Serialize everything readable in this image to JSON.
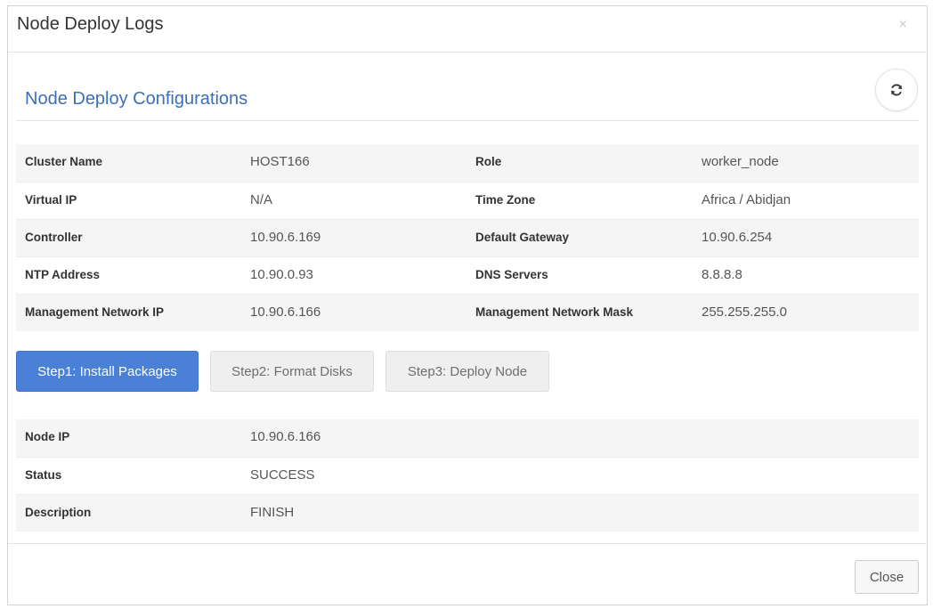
{
  "modal": {
    "title": "Node Deploy Logs",
    "close_symbol": "×",
    "close_icon": "close-icon"
  },
  "section": {
    "title": "Node Deploy Configurations",
    "refresh_icon": "refresh-icon"
  },
  "config": {
    "rows": [
      [
        {
          "label": "Cluster Name",
          "value": "HOST166"
        },
        {
          "label": "Role",
          "value": "worker_node"
        }
      ],
      [
        {
          "label": "Virtual IP",
          "value": "N/A"
        },
        {
          "label": "Time Zone",
          "value": "Africa / Abidjan"
        }
      ],
      [
        {
          "label": "Controller",
          "value": "10.90.6.169"
        },
        {
          "label": "Default Gateway",
          "value": "10.90.6.254"
        }
      ],
      [
        {
          "label": "NTP Address",
          "value": "10.90.0.93"
        },
        {
          "label": "DNS Servers",
          "value": "8.8.8.8"
        }
      ],
      [
        {
          "label": "Management Network IP",
          "value": "10.90.6.166"
        },
        {
          "label": "Management Network Mask",
          "value": "255.255.255.0"
        }
      ]
    ]
  },
  "tabs": [
    {
      "label": "Step1: Install Packages",
      "active": true
    },
    {
      "label": "Step2: Format Disks",
      "active": false
    },
    {
      "label": "Step3: Deploy Node",
      "active": false
    }
  ],
  "status": {
    "rows": [
      {
        "label": "Node IP",
        "value": "10.90.6.166"
      },
      {
        "label": "Status",
        "value": "SUCCESS"
      },
      {
        "label": "Description",
        "value": "FINISH"
      }
    ]
  },
  "footer": {
    "close_label": "Close"
  },
  "colors": {
    "accent": "#4a80d6",
    "section_title": "#3c6fb5",
    "row_shade": "#f5f5f5"
  }
}
